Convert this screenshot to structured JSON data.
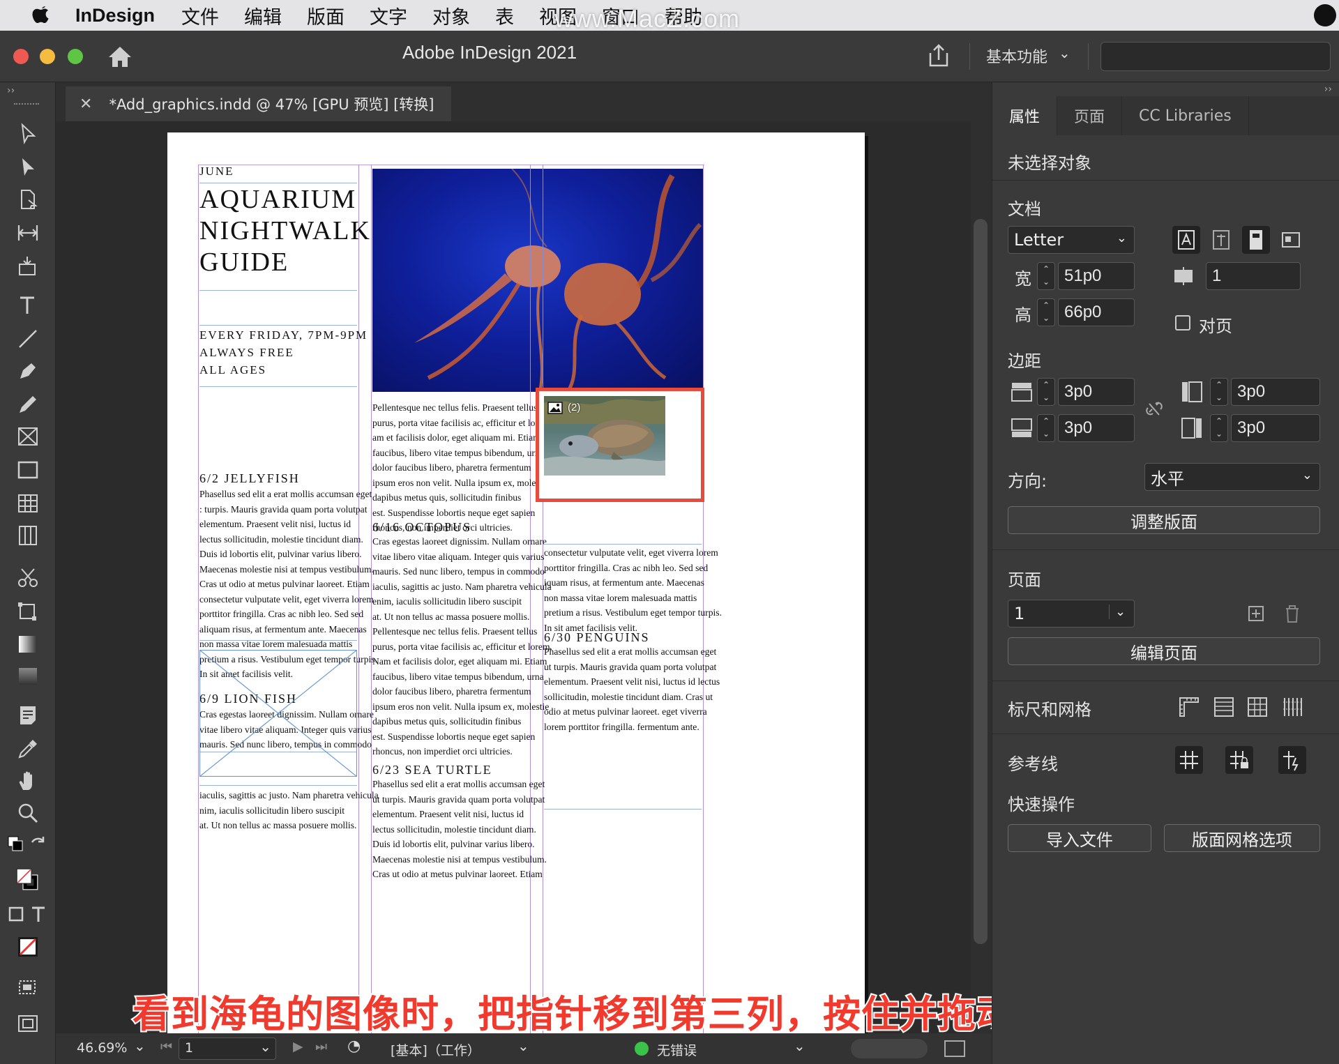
{
  "menubar": {
    "app_name": "InDesign",
    "items": [
      "文件",
      "编辑",
      "版面",
      "文字",
      "对象",
      "表",
      "视图",
      "窗口",
      "帮助"
    ],
    "watermark": "www.MacZ.com"
  },
  "titlebar": {
    "title": "Adobe InDesign 2021",
    "workspace": "基本功能"
  },
  "document_tab": {
    "label": "*Add_graphics.indd @ 47% [GPU 预览] [转换]"
  },
  "page": {
    "col1": {
      "month": "JUNE",
      "title_lines": [
        "AQUARIUM",
        "NIGHTWALK",
        "GUIDE"
      ],
      "info_lines": [
        "EVERY FRIDAY, 7PM-9PM",
        "ALWAYS FREE",
        "ALL AGES"
      ],
      "jellyfish_head": "6/2 JELLYFISH",
      "jellyfish_lines": [
        "Phasellus sed elit a erat mollis accumsan eget",
        ": turpis. Mauris gravida quam porta volutpat",
        "elementum. Praesent velit nisi, luctus id",
        "lectus sollicitudin, molestie tincidunt diam.",
        "Duis id lobortis elit, pulvinar varius libero.",
        "Maecenas molestie nisi at tempus vestibulum.",
        "Cras ut odio at metus pulvinar laoreet. Etiam",
        "consectetur vulputate velit, eget viverra lorem",
        "porttitor fringilla. Cras ac nibh leo. Sed sed",
        "aliquam risus, at fermentum ante. Maecenas",
        "non massa vitae lorem malesuada mattis",
        "pretium a risus. Vestibulum eget tempor turpis.",
        "In sit amet facilisis velit."
      ],
      "lionfish_head": "6/9 LION FISH",
      "lionfish_lines": [
        "Cras egestas laoreet dignissim. Nullam ornare",
        "vitae libero vitae aliquam. Integer quis varius",
        "mauris. Sed nunc libero, tempus in commodo"
      ],
      "bottom_lines": [
        "iaculis, sagittis ac justo. Nam pharetra vehicula",
        "nim, iaculis sollicitudin libero suscipit",
        "at. Ut non tellus ac massa posuere mollis."
      ]
    },
    "col2": {
      "intro_lines": [
        "Pellentesque nec tellus felis. Praesent tellus",
        "purus, porta vitae facilisis ac, efficitur et lorem.",
        "am et facilisis dolor, eget aliquam mi. Etiam",
        "faucibus, libero vitae tempus bibendum, urna",
        "dolor faucibus libero, pharetra fermentum",
        "ipsum eros non velit. Nulla ipsum ex, molestie",
        "dapibus metus quis, sollicitudin finibus",
        "est. Suspendisse lobortis neque eget sapien",
        "rhoncus, non imperdiet orci ultricies."
      ],
      "octopus_head": "6/16 OCTOPUS",
      "octopus_lines": [
        "Cras egestas laoreet dignissim. Nullam ornare",
        "vitae libero vitae aliquam. Integer quis varius",
        "mauris. Sed nunc libero, tempus in commodo",
        "iaculis, sagittis ac justo. Nam pharetra vehicula",
        "enim, iaculis sollicitudin libero suscipit",
        "at. Ut non tellus ac massa posuere mollis.",
        "Pellentesque nec tellus felis. Praesent tellus",
        "purus, porta vitae facilisis ac, efficitur et lorem.",
        "Nam et facilisis dolor, eget aliquam mi. Etiam",
        "faucibus, libero vitae tempus bibendum, urna",
        "dolor faucibus libero, pharetra fermentum",
        "ipsum eros non velit. Nulla ipsum ex, molestie",
        "dapibus metus quis, sollicitudin finibus",
        "est. Suspendisse lobortis neque eget sapien",
        "rhoncus, non imperdiet orci ultricies."
      ],
      "turtle_head": "6/23 SEA TURTLE",
      "turtle_lines": [
        "Phasellus sed elit a erat mollis accumsan eget",
        "ut turpis. Mauris gravida quam porta volutpat",
        "elementum. Praesent velit nisi, luctus id",
        "lectus sollicitudin, molestie tincidunt diam.",
        "Duis id lobortis elit, pulvinar varius libero.",
        "Maecenas molestie nisi at tempus vestibulum.",
        "Cras ut odio at metus pulvinar laoreet. Etiam"
      ]
    },
    "col3": {
      "place_count": "(2)",
      "intro_lines": [
        "consectetur vulputate velit, eget viverra lorem",
        "porttitor fringilla. Cras ac nibh leo. Sed sed",
        "iquam risus, at fermentum ante. Maecenas",
        "non massa vitae lorem malesuada mattis",
        "pretium a risus. Vestibulum eget tempor turpis.",
        "In sit amet facilisis velit."
      ],
      "penguins_head": "6/30 PENGUINS",
      "penguins_lines": [
        "Phasellus sed elit a erat mollis accumsan eget",
        "ut turpis. Mauris gravida quam porta volutpat",
        "elementum. Praesent velit nisi, luctus id lectus",
        "sollicitudin, molestie tincidunt diam. Cras ut",
        "odio at metus pulvinar laoreet. eget viverra",
        "lorem porttitor fringilla. fermentum ante."
      ]
    }
  },
  "statusbar": {
    "zoom": "46.69%",
    "page": "1",
    "style": "[基本]（工作）",
    "preflight": "无错误",
    "preflight_color": "#3bc24a"
  },
  "caption": "看到海龟的图像时，把指针移到第三列，按住并拖动以创建框架",
  "panel": {
    "tabs": [
      "属性",
      "页面",
      "CC Libraries"
    ],
    "selection": "未选择对象",
    "document_label": "文档",
    "page_size": "Letter",
    "width_label": "宽",
    "width_value": "51p0",
    "height_label": "高",
    "height_value": "66p0",
    "pages_value": "1",
    "facing_label": "对页",
    "margins_label": "边距",
    "margin_top": "3p0",
    "margin_bottom": "3p0",
    "margin_left": "3p0",
    "margin_right": "3p0",
    "orientation_label": "方向:",
    "orientation_value": "水平",
    "adjust_layout": "调整版面",
    "page_label": "页面",
    "page_value": "1",
    "edit_page": "编辑页面",
    "rulers_label": "标尺和网格",
    "guides_label": "参考线",
    "quick_actions_label": "快速操作",
    "import_file": "导入文件",
    "layout_grid": "版面网格选项"
  },
  "colors": {
    "accent_frame": "#e84a3c",
    "caption": "#f03a2e"
  }
}
